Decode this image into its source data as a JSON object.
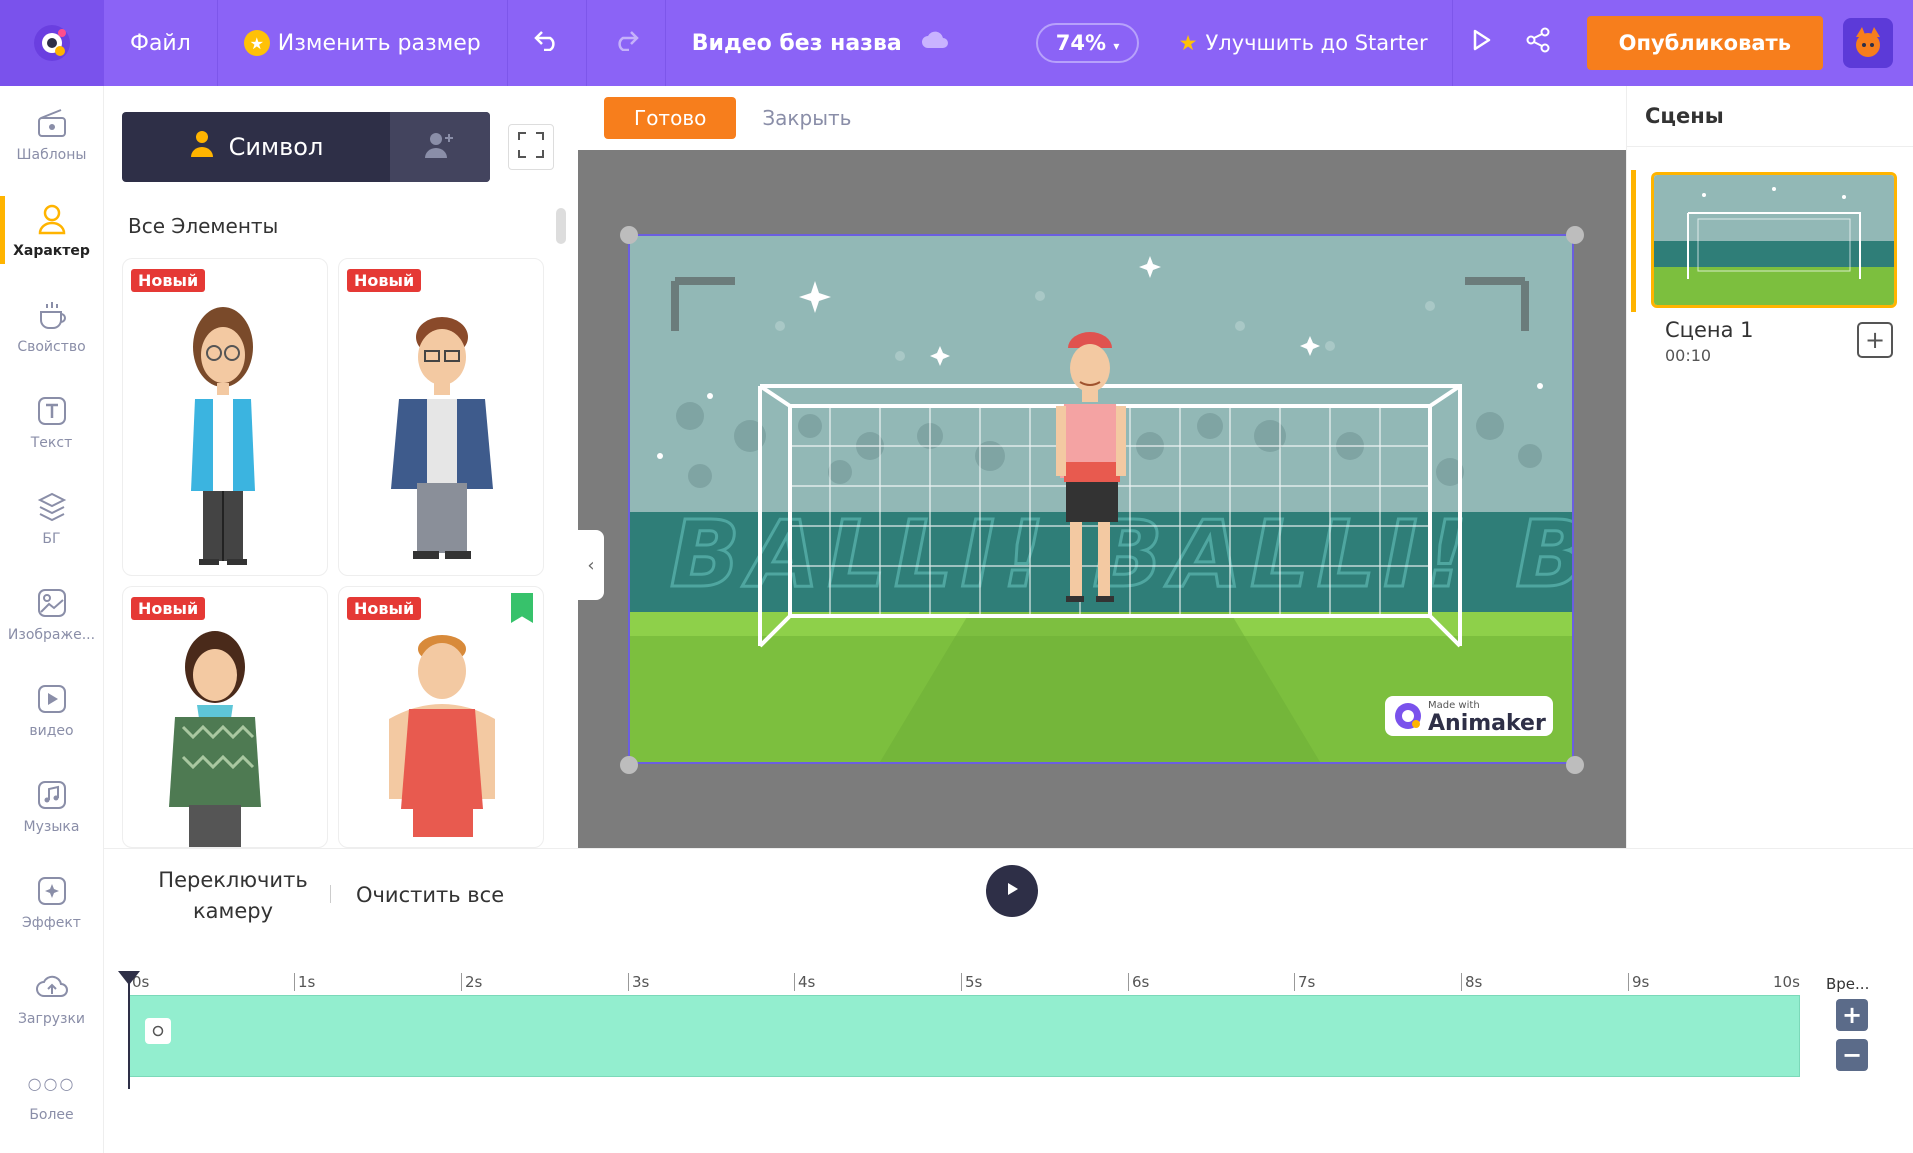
{
  "topbar": {
    "file": "Файл",
    "resize": "Изменить размер",
    "title": "Видео без назва",
    "zoom": "74%",
    "upgrade": "Улучшить до Starter",
    "publish": "Опубликовать"
  },
  "leftnav": [
    {
      "label": "Шаблоны",
      "icon": "templates-icon"
    },
    {
      "label": "Характер",
      "icon": "character-icon",
      "active": true
    },
    {
      "label": "Свойство",
      "icon": "property-icon"
    },
    {
      "label": "Текст",
      "icon": "text-icon"
    },
    {
      "label": "БГ",
      "icon": "background-icon"
    },
    {
      "label": "Изображе...",
      "icon": "image-icon"
    },
    {
      "label": "видео",
      "icon": "video-icon"
    },
    {
      "label": "Музыка",
      "icon": "music-icon"
    },
    {
      "label": "Эффект",
      "icon": "effect-icon"
    },
    {
      "label": "Загрузки",
      "icon": "upload-icon"
    },
    {
      "label": "Более",
      "icon": "more-icon"
    }
  ],
  "panel": {
    "tab_symbol": "Символ",
    "section_title": "Все Элементы",
    "badge": "Новый"
  },
  "editor": {
    "done": "Готово",
    "close": "Закрыть",
    "banner_text": "BALLI! BALLI! BAL",
    "watermark_small": "Made with",
    "watermark_brand": "Animaker"
  },
  "scenes": {
    "title": "Сцены",
    "scene_name": "Сцена 1",
    "scene_time": "00:10"
  },
  "timeline": {
    "switch_camera": "Переключить камеру",
    "clear_all": "Очистить все",
    "ticks": [
      "0s",
      "1s",
      "2s",
      "3s",
      "4s",
      "5s",
      "6s",
      "7s",
      "8s",
      "9s",
      "10s"
    ],
    "time_label": "Вре..."
  },
  "colors": {
    "topbar": "#8b63f6",
    "accent": "#f77e1c",
    "track": "#93eecf",
    "active_nav": "#ffb400"
  }
}
